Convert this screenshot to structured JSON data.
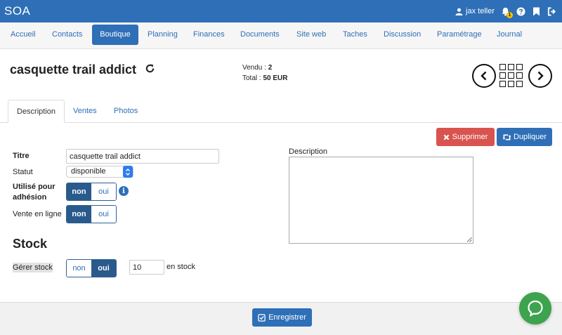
{
  "app": {
    "brand": "SOA"
  },
  "user": {
    "name": "jax teller",
    "notifications": "1"
  },
  "icons": [
    "user-icon",
    "bell-icon",
    "help-icon",
    "bookmark-icon",
    "logout-icon",
    "refresh-icon",
    "chevron-left-icon",
    "grid-icon",
    "chevron-right-icon",
    "times-icon",
    "retweet-icon",
    "info-icon",
    "check-square-icon",
    "chat-icon"
  ],
  "nav": {
    "items": [
      {
        "label": "Accueil"
      },
      {
        "label": "Contacts"
      },
      {
        "label": "Boutique"
      },
      {
        "label": "Planning"
      },
      {
        "label": "Finances"
      },
      {
        "label": "Documents"
      },
      {
        "label": "Site web"
      },
      {
        "label": "Taches"
      },
      {
        "label": "Discussion"
      },
      {
        "label": "Paramétrage"
      },
      {
        "label": "Journal"
      }
    ],
    "active": "Boutique"
  },
  "product": {
    "title": "casquette trail addict",
    "sold_label": "Vendu :",
    "sold_value": "2",
    "total_label": "Total :",
    "total_value": "50 EUR"
  },
  "tabs": [
    {
      "label": "Description"
    },
    {
      "label": "Ventes"
    },
    {
      "label": "Photos"
    }
  ],
  "actions": {
    "delete_label": "Supprimer",
    "duplicate_label": "Dupliquer"
  },
  "form": {
    "titre_label": "Titre",
    "titre_value": "casquette trail addict",
    "statut_label": "Statut",
    "statut_value": "disponible",
    "adhesion_label_line1": "Utilisé pour",
    "adhesion_label_line2": "adhésion",
    "adhesion_off": "non",
    "adhesion_on": "oui",
    "vente_label": "Vente en ligne",
    "vente_off": "non",
    "vente_on": "oui",
    "description_label": "Description",
    "description_value": ""
  },
  "stock": {
    "title": "Stock",
    "gerer_label": "Gérer stock",
    "gerer_off": "non",
    "gerer_on": "oui",
    "quantity": "10",
    "unit": "en stock"
  },
  "footer": {
    "save_label": "Enregistrer"
  },
  "colors": {
    "primary": "#2e6fb7",
    "danger": "#d9534f",
    "chat": "#3da34e",
    "toggle_active": "#295a8b"
  }
}
